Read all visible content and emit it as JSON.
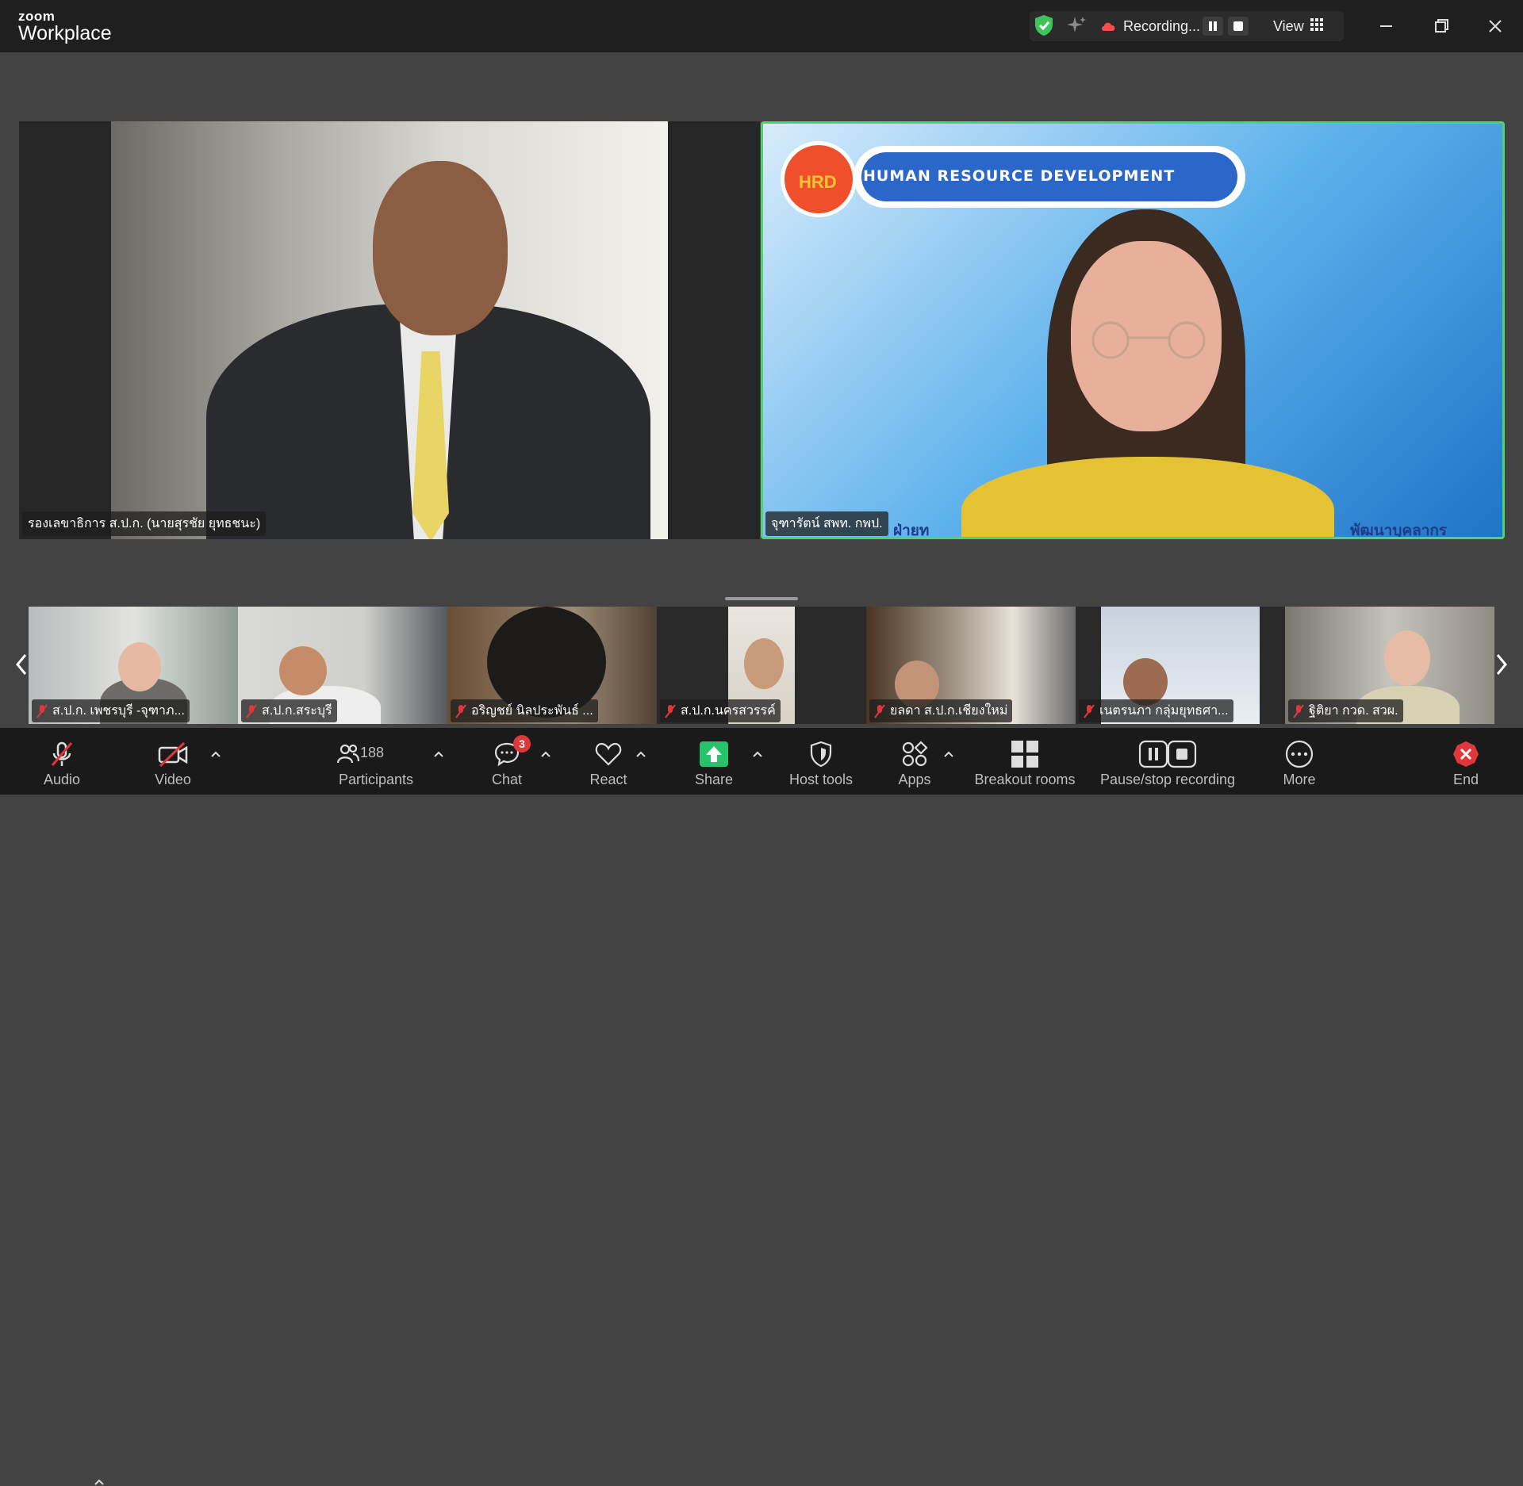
{
  "app": {
    "brand_small": "zoom",
    "brand_name": "Workplace"
  },
  "header": {
    "status": "Recording...",
    "view_label": "View",
    "icons": [
      "shield-check-icon",
      "sparkle-icon",
      "cloud-icon",
      "pause-icon",
      "stop-icon",
      "grid-icon",
      "minimize-icon",
      "restore-icon",
      "close-icon"
    ],
    "colors": {
      "shield": "#3ec45b",
      "cloud": "#ff4b4b"
    }
  },
  "main": {
    "left": {
      "name": "รองเลขาธิการ ส.ป.ก. (นายสุรชัย ยุทธชนะ)"
    },
    "right": {
      "name": "จุฑารัตน์ สพท. กพป.",
      "slide_title": "HUMAN RESOURCE DEVELOPMENT",
      "slide_logo": "HRD",
      "slide_footer_left": "ฝ่ายท",
      "slide_footer_right": "พัฒนาบุคลากร",
      "active_border_color": "#4ed36f"
    }
  },
  "gallery": [
    {
      "name": "ส.ป.ก. เพชรบุรี -จุฑาภ..."
    },
    {
      "name": "ส.ป.ก.สระบุรี"
    },
    {
      "name": "อริญชย์ นิลประพันธ์ ..."
    },
    {
      "name": "ส.ป.ก.นครสวรรค์"
    },
    {
      "name": "ยลดา ส.ป.ก.เชียงใหม่"
    },
    {
      "name": "เนตรนภา กลุ่มยุทธศา..."
    },
    {
      "name": "ฐิติยา กวด. สวผ."
    }
  ],
  "toolbar": {
    "audio": "Audio",
    "video": "Video",
    "participants": "Participants",
    "participant_count": "188",
    "chat": "Chat",
    "chat_badge": "3",
    "react": "React",
    "share": "Share",
    "host_tools": "Host tools",
    "apps": "Apps",
    "breakout": "Breakout rooms",
    "pause_stop": "Pause/stop recording",
    "more": "More",
    "end": "End",
    "colors": {
      "share": "#27c26b",
      "end": "#e0373d",
      "muted": "#e0373d"
    }
  }
}
